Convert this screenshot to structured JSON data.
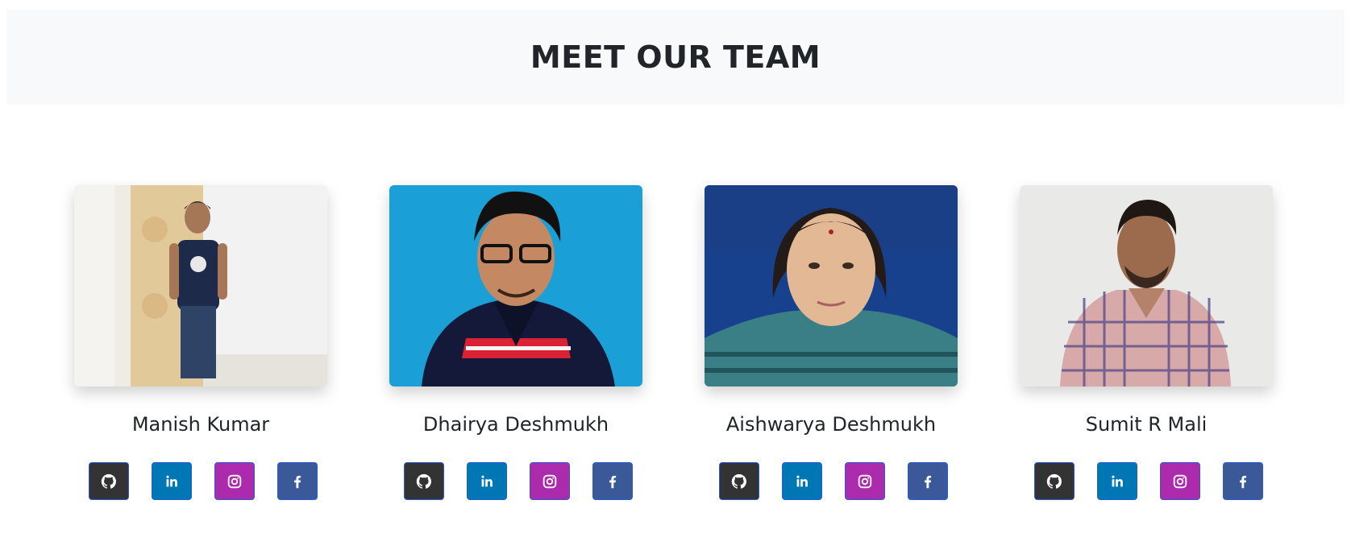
{
  "header": {
    "title": "MEET OUR TEAM"
  },
  "members": [
    {
      "name": "Manish Kumar"
    },
    {
      "name": "Dhairya Deshmukh"
    },
    {
      "name": "Aishwarya Deshmukh"
    },
    {
      "name": "Sumit R Mali"
    }
  ],
  "social_icons": [
    "github-icon",
    "linkedin-icon",
    "instagram-icon",
    "facebook-icon"
  ],
  "colors": {
    "github": "#333333",
    "linkedin": "#0077b5",
    "instagram": "#ac2bac",
    "facebook": "#3b5998",
    "header_bg": "#f8f9fa"
  }
}
